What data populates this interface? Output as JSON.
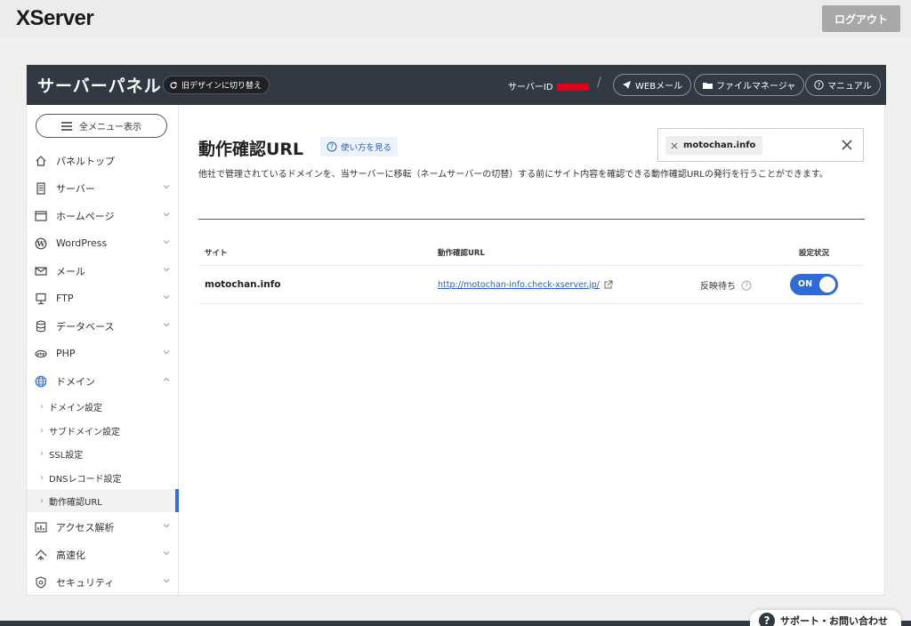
{
  "topbar": {
    "logo": "XServer",
    "logout_label": "ログアウト"
  },
  "header": {
    "title": "サーバーパネル",
    "old_design_label": "旧デザインに切り替え",
    "server_id_label": "サーバーID",
    "web_mail_label": "WEBメール",
    "file_manager_label": "ファイルマネージャ",
    "manual_label": "マニュアル"
  },
  "sidebar": {
    "menu_all_label": "全メニュー表示",
    "items": [
      {
        "label": "パネルトップ",
        "icon": "home-icon"
      },
      {
        "label": "サーバー",
        "icon": "server-icon"
      },
      {
        "label": "ホームページ",
        "icon": "window-icon"
      },
      {
        "label": "WordPress",
        "icon": "wordpress-icon"
      },
      {
        "label": "メール",
        "icon": "mail-icon"
      },
      {
        "label": "FTP",
        "icon": "monitor-icon"
      },
      {
        "label": "データベース",
        "icon": "database-icon"
      },
      {
        "label": "PHP",
        "icon": "php-icon"
      },
      {
        "label": "ドメイン",
        "icon": "globe-icon"
      },
      {
        "label": "アクセス解析",
        "icon": "chart-icon"
      },
      {
        "label": "高速化",
        "icon": "speed-icon"
      },
      {
        "label": "セキュリティ",
        "icon": "shield-icon"
      }
    ],
    "domain_sub": [
      {
        "label": "ドメイン設定"
      },
      {
        "label": "サブドメイン設定"
      },
      {
        "label": "SSL設定"
      },
      {
        "label": "DNSレコード設定"
      },
      {
        "label": "動作確認URL"
      }
    ]
  },
  "main": {
    "title": "動作確認URL",
    "howto_label": "使い方を見る",
    "filter_chip": "motochan.info",
    "description": "他社で管理されているドメインを、当サーバーに移転（ネームサーバーの切替）する前にサイト内容を確認できる動作確認URLの発行を行うことができます。",
    "table": {
      "headers": {
        "site": "サイト",
        "url": "動作確認URL",
        "status": "設定状況"
      },
      "rows": [
        {
          "site": "motochan.info",
          "url": "http://motochan-info.check-xserver.jp/",
          "status_text": "反映待ち",
          "toggle": "ON"
        }
      ]
    }
  },
  "support": {
    "label": "サポート・お問い合わせ"
  },
  "colors": {
    "header_bg": "#333942",
    "accent": "#2f6bd6"
  }
}
